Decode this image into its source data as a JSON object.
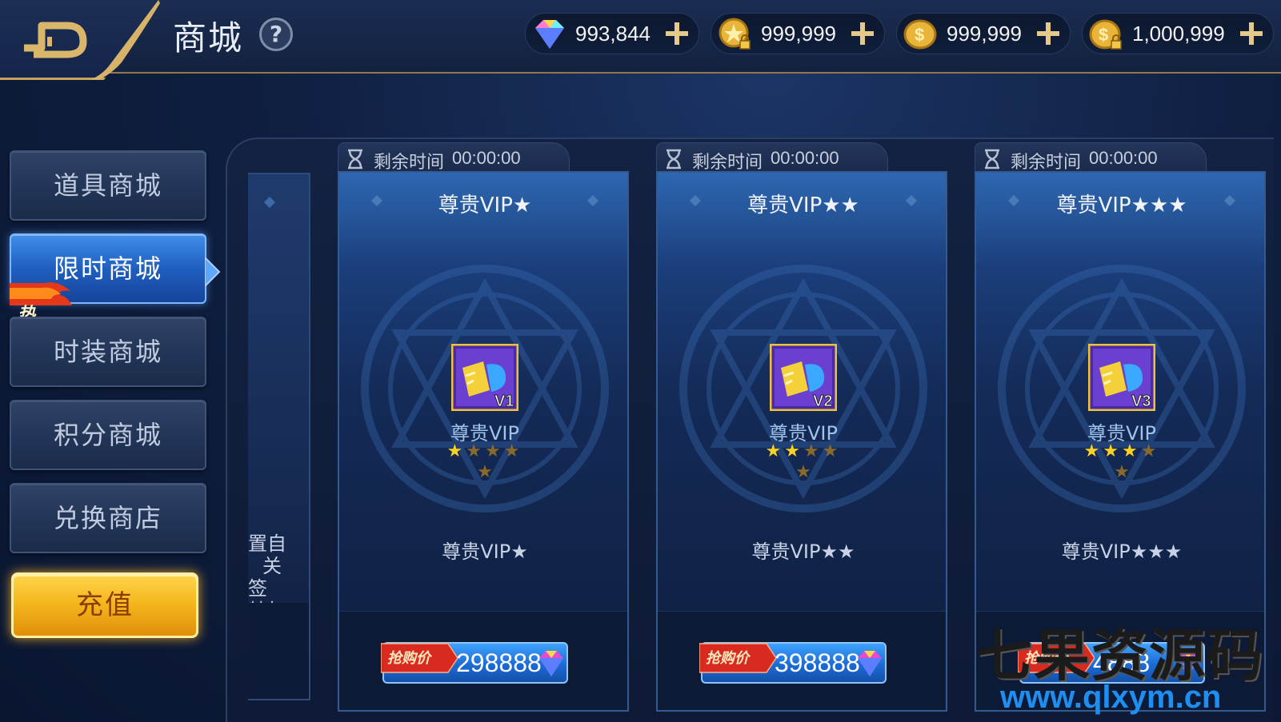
{
  "header": {
    "title": "商城",
    "help_label": "?"
  },
  "currencies": [
    {
      "icon": "gem-icon",
      "value": "993,844"
    },
    {
      "icon": "locked-gold-coin-icon",
      "value": "999,999"
    },
    {
      "icon": "gold-coin-icon",
      "value": "999,999"
    },
    {
      "icon": "locked-coin-stack-icon",
      "value": "1,000,999"
    }
  ],
  "sidebar": {
    "items": [
      {
        "label": "道具商城",
        "active": false
      },
      {
        "label": "限时商城",
        "active": true,
        "badge": "热"
      },
      {
        "label": "时装商城",
        "active": false
      },
      {
        "label": "积分商城",
        "active": false
      },
      {
        "label": "兑换商店",
        "active": false
      }
    ],
    "recharge_label": "充值"
  },
  "partial_card": {
    "text_lines": [
      "置自",
      "关",
      "签",
      "特权"
    ]
  },
  "cards": [
    {
      "timer_label": "剩余时间",
      "timer_value": "00:00:00",
      "title": "尊贵VIP★",
      "icon_badge": "V1",
      "item_name": "尊贵VIP",
      "stars_filled": 1,
      "stars_total": 5,
      "description": "尊贵VIP★",
      "price_tag": "抢购价",
      "price": "298888"
    },
    {
      "timer_label": "剩余时间",
      "timer_value": "00:00:00",
      "title": "尊贵VIP★★",
      "icon_badge": "V2",
      "item_name": "尊贵VIP",
      "stars_filled": 2,
      "stars_total": 5,
      "description": "尊贵VIP★★",
      "price_tag": "抢购价",
      "price": "398888"
    },
    {
      "timer_label": "剩余时间",
      "timer_value": "00:00:00",
      "title": "尊贵VIP★★★",
      "icon_badge": "V3",
      "item_name": "尊贵VIP",
      "stars_filled": 3,
      "stars_total": 5,
      "description": "尊贵VIP★★★",
      "price_tag": "抢购价",
      "price": "4888"
    }
  ],
  "watermark": {
    "cn": "七果资源码",
    "url": "www.qlxym.cn"
  },
  "colors": {
    "accent_gold": "#c8a35b",
    "active_blue": "#2f7be0",
    "recharge_yellow": "#f4b41b",
    "star_filled": "#ffd21f",
    "star_empty": "#8a6a2a"
  }
}
